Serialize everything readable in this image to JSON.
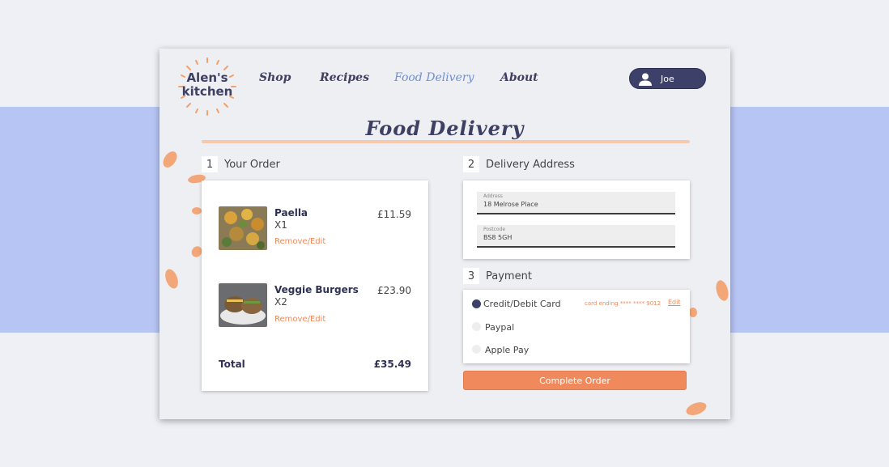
{
  "brand": {
    "name": "Alen's kitchen",
    "line1": "Alen's",
    "line2": "kitchen"
  },
  "nav": {
    "items": [
      {
        "label": "Shop",
        "active": false
      },
      {
        "label": "Recipes",
        "active": false
      },
      {
        "label": "Food Delivery",
        "active": true
      },
      {
        "label": "About",
        "active": false
      }
    ]
  },
  "user": {
    "name": "Joe",
    "icon": "user-icon"
  },
  "page": {
    "title": "Food Delivery"
  },
  "order": {
    "step": "1",
    "heading": "Your Order",
    "items": [
      {
        "name": "Paella",
        "qty": "X1",
        "price": "£11.59",
        "action": "Remove/Edit"
      },
      {
        "name": "Veggie Burgers",
        "qty": "X2",
        "price": "£23.90",
        "action": "Remove/Edit"
      }
    ],
    "total_label": "Total",
    "total_value": "£35.49"
  },
  "delivery": {
    "step": "2",
    "heading": "Delivery Address",
    "address_label": "Address",
    "address_value": "18 Melrose Place",
    "postcode_label": "Postcode",
    "postcode_value": "BS8 5GH"
  },
  "payment": {
    "step": "3",
    "heading": "Payment",
    "options": [
      {
        "label": "Credit/Debit Card",
        "selected": true
      },
      {
        "label": "Paypal",
        "selected": false
      },
      {
        "label": "Apple Pay",
        "selected": false
      }
    ],
    "card_ending": "card ending **** **** 9012",
    "edit_label": "Edit"
  },
  "actions": {
    "complete_label": "Complete Order"
  },
  "colors": {
    "accent": "#f08a5d",
    "navy": "#3d4169",
    "band": "#b7c5f5",
    "active_nav": "#6f8ed3"
  }
}
